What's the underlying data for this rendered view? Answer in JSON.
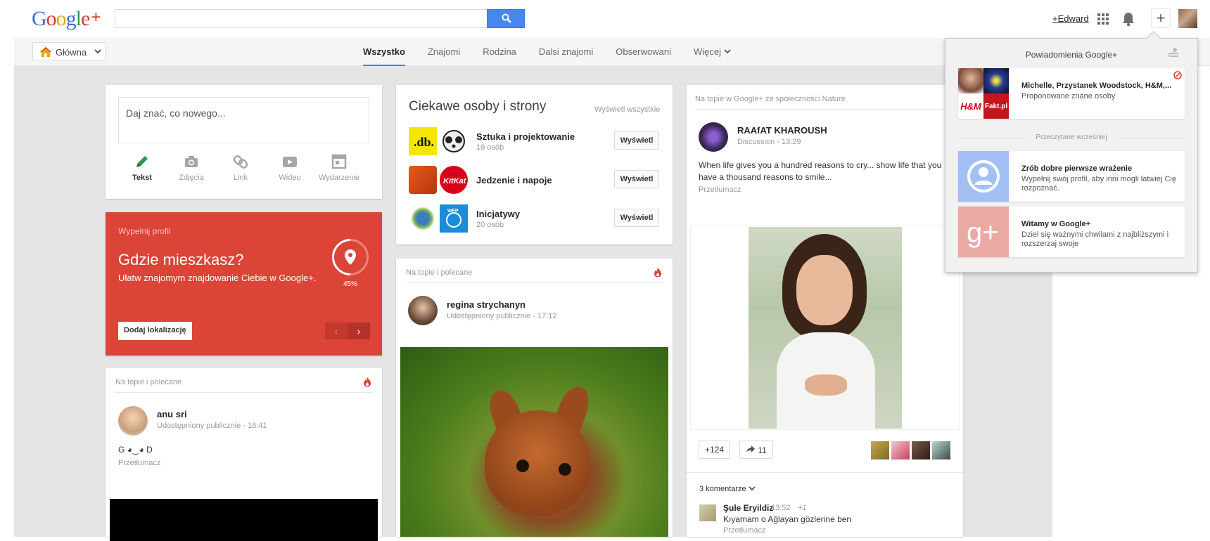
{
  "header": {
    "logo_text": "Google+",
    "user_link": "+Edward"
  },
  "subnav": {
    "home_label": "Główna",
    "tabs": [
      "Wszystko",
      "Znajomi",
      "Rodzina",
      "Dalsi znajomi",
      "Obserwowani",
      "Więcej"
    ],
    "active_tab": "Wszystko"
  },
  "composer": {
    "placeholder": "Daj znać, co nowego...",
    "types": [
      {
        "label": "Tekst",
        "icon": "pencil-icon"
      },
      {
        "label": "Zdjęcia",
        "icon": "camera-icon"
      },
      {
        "label": "Link",
        "icon": "link-icon"
      },
      {
        "label": "Wideo",
        "icon": "video-icon"
      },
      {
        "label": "Wydarzenie",
        "icon": "calendar-icon"
      }
    ]
  },
  "profile_card": {
    "small": "Wypełnij profil",
    "title": "Gdzie mieszkasz?",
    "subtitle": "Ułatw znajomym znajdowanie Ciebie w Google+.",
    "progress": "45%",
    "button": "Dodaj lokalizację",
    "color": "#db4437"
  },
  "feed1": {
    "header": "Na topie i polecane",
    "author": "anu sri",
    "meta": "Udostępniony publicznie  -  18:41",
    "text": "G ◕‿◕ D",
    "translate": "Przetłumacz"
  },
  "people": {
    "title": "Ciekawe osoby i strony",
    "view_all": "Wyświetl wszystkie",
    "rows": [
      {
        "name": "Sztuka i projektowanie",
        "count": "19 osób",
        "button": "Wyświetl"
      },
      {
        "name": "Jedzenie i napoje",
        "count": "",
        "button": "Wyświetl"
      },
      {
        "name": "Inicjatywy",
        "count": "20 osób",
        "button": "Wyświetl"
      }
    ]
  },
  "feed2": {
    "header": "Na topie i polecane",
    "author": "regina strychanyn",
    "meta": "Udostępniony publicznie  -  17:12"
  },
  "feed3": {
    "header": "Na topie w Google+ ze społeczności Nature",
    "author": "RAAfAT KHAROUSH",
    "meta": "Discussion  -  13:29",
    "text": "When life gives you a hundred reasons to cry... show life that you have a thousand reasons to smile...",
    "translate": "Przetłumacz",
    "plus_count": "+124",
    "share_count": "11",
    "comments_label": "3 komentarze",
    "comment": {
      "name": "Şule Eryildiz",
      "time": "13:52",
      "plus": "+1",
      "text": "Kıyamam o Ağlayan gözlerine ben",
      "translate": "Przetłumacz"
    }
  },
  "notifications": {
    "title": "Powiadomienia Google+",
    "section_read": "Przeczytane wcześniej",
    "items": [
      {
        "title": "Michelle, Przystanek Woodstock, H&M,...",
        "text": "Proponowane znane osoby"
      },
      {
        "title": "Zrób dobre pierwsze wrażenie",
        "text": "Wypełnij swój profil, aby inni mogli łatwiej Cię rozpoznać."
      },
      {
        "title": "Witamy w Google+",
        "text": "Dziel się ważnymi chwilami z najbliższymi i rozszerzaj swoje"
      }
    ],
    "hm_label": "H&M",
    "fakt_label": "Fakt.pl"
  }
}
